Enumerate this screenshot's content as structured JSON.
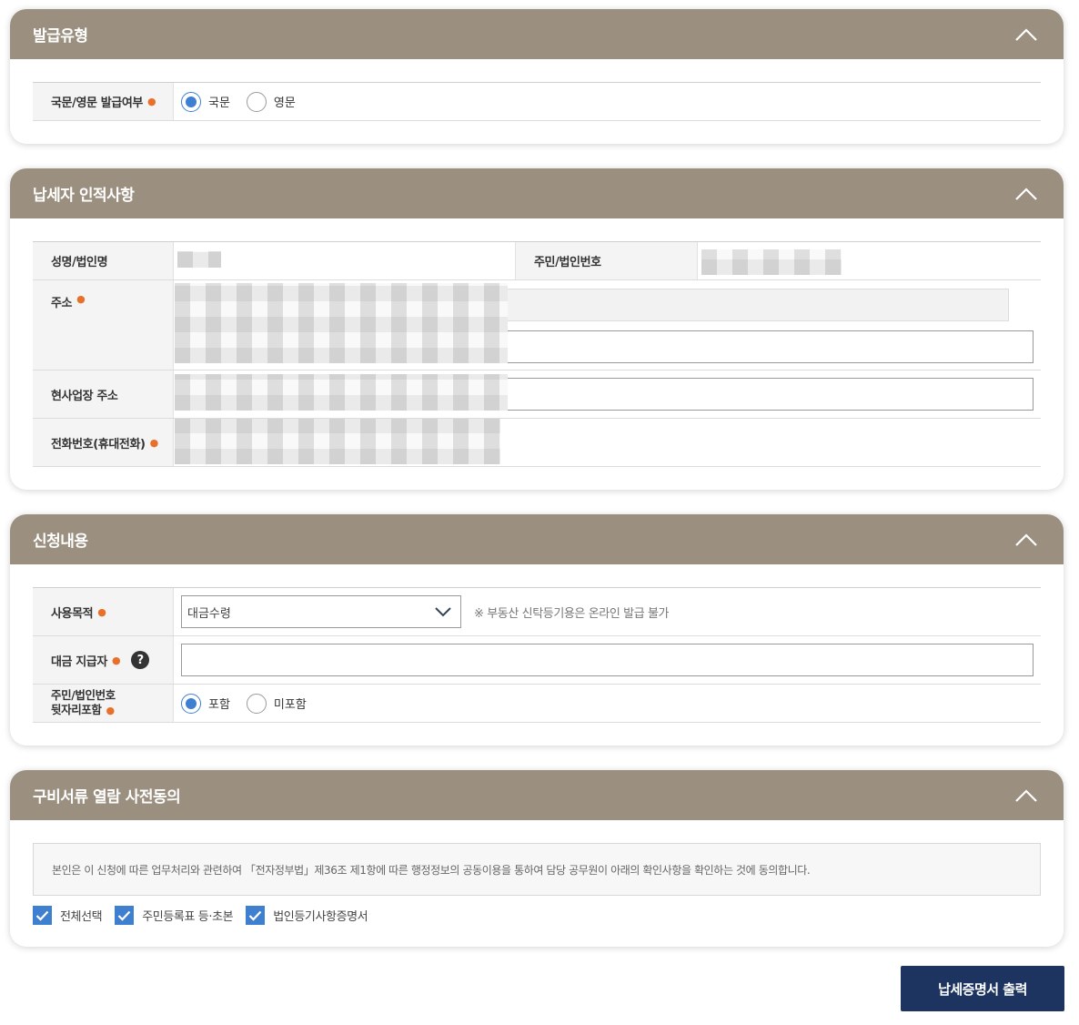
{
  "issue_type": {
    "title": "발급유형",
    "label": "국문/영문 발급여부",
    "options": [
      "국문",
      "영문"
    ],
    "selected": "국문"
  },
  "taxpayer": {
    "title": "납세자 인적사항",
    "name_label": "성명/법인명",
    "id_label": "주민/법인번호",
    "address_label": "주소",
    "business_address_label": "현사업장 주소",
    "phone_label": "전화번호(휴대전화)"
  },
  "application": {
    "title": "신청내용",
    "purpose_label": "사용목적",
    "purpose_value": "대금수령",
    "purpose_note": "※ 부동산 신탁등기용은 온라인 발급 불가",
    "payer_label": "대금 지급자",
    "help_symbol": "?",
    "suffix_label_line1": "주민/법인번호",
    "suffix_label_line2": "뒷자리포함",
    "suffix_options": [
      "포함",
      "미포함"
    ],
    "suffix_selected": "포함"
  },
  "consent": {
    "title": "구비서류 열람 사전동의",
    "text": "본인은 이 신청에 따른 업무처리와 관련하여 「전자정부법」제36조 제1항에 따른 행정정보의 공동이용을 통하여 담당 공무원이 아래의 확인사항을 확인하는 것에 동의합니다.",
    "checks": [
      "전체선택",
      "주민등록표 등·초본",
      "법인등기사항증명서"
    ]
  },
  "actions": {
    "print": "납세증명서 출력"
  },
  "colors": {
    "header": "#9b9080",
    "accent": "#3f7fd0",
    "button": "#1d3461",
    "required": "#e8702a"
  }
}
